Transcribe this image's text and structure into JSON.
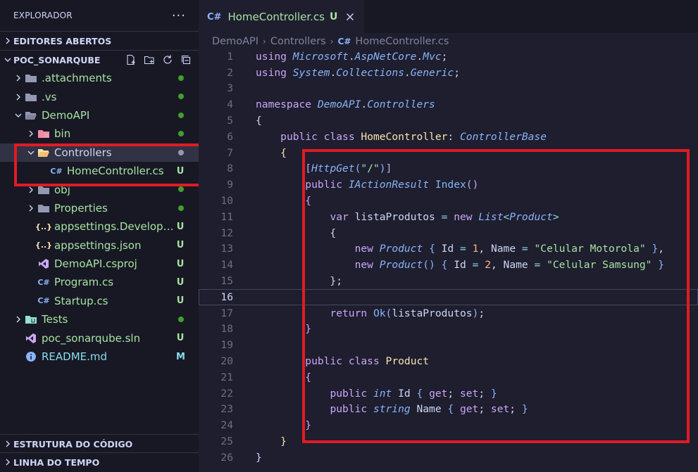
{
  "sidebar": {
    "title": "EXPLORADOR",
    "more": "···",
    "open_editors": "EDITORES ABERTOS",
    "project": "POC_SONARQUBE",
    "outline": "ESTRUTURA DO CÓDIGO",
    "timeline": "LINHA DO TEMPO",
    "tree": [
      {
        "label": "attachments",
        "prefix": ".",
        "display": ".attachments",
        "badge": "dot",
        "icon": "folder-icon"
      },
      {
        "display": ".vs",
        "badge": "dot",
        "icon": "folder-icon"
      },
      {
        "display": "DemoAPI",
        "badge": "dot",
        "icon": "folder-open-icon"
      },
      {
        "display": "bin",
        "badge": "dot",
        "icon": "folder-bin-icon"
      },
      {
        "display": "Controllers",
        "badge": "dot-grey",
        "icon": "folder-controllers-icon"
      },
      {
        "display": "HomeController.cs",
        "badge": "U",
        "icon": "csharp-icon"
      },
      {
        "display": "obj",
        "badge": "dot",
        "icon": "folder-icon"
      },
      {
        "display": "Properties",
        "badge": "dot",
        "icon": "folder-icon"
      },
      {
        "display": "appsettings.Developme...",
        "badge": "U",
        "icon": "json-icon"
      },
      {
        "display": "appsettings.json",
        "badge": "U",
        "icon": "json-icon"
      },
      {
        "display": "DemoAPI.csproj",
        "badge": "U",
        "icon": "vs-icon"
      },
      {
        "display": "Program.cs",
        "badge": "U",
        "icon": "csharp-icon"
      },
      {
        "display": "Startup.cs",
        "badge": "U",
        "icon": "csharp-icon"
      },
      {
        "display": "Tests",
        "badge": "dot",
        "icon": "folder-tests-icon"
      },
      {
        "display": "poc_sonarqube.sln",
        "badge": "U",
        "icon": "vs-icon"
      },
      {
        "display": "README.md",
        "badge": "M",
        "icon": "info-icon"
      }
    ]
  },
  "editor": {
    "tab": {
      "icon": "C#",
      "name": "HomeController.cs",
      "status": "U"
    },
    "breadcrumb": [
      "DemoAPI",
      "Controllers",
      "HomeController.cs"
    ],
    "breadcrumb_icon": "C#",
    "current_line": 16,
    "lines": [
      [
        [
          "k",
          "using"
        ],
        [
          "pl",
          " "
        ],
        [
          "t",
          "Microsoft"
        ],
        [
          "pl",
          "."
        ],
        [
          "t",
          "AspNetCore"
        ],
        [
          "pl",
          "."
        ],
        [
          "t",
          "Mvc"
        ],
        [
          "pl",
          ";"
        ]
      ],
      [
        [
          "k",
          "using"
        ],
        [
          "pl",
          " "
        ],
        [
          "t",
          "System"
        ],
        [
          "pl",
          "."
        ],
        [
          "t",
          "Collections"
        ],
        [
          "pl",
          "."
        ],
        [
          "t",
          "Generic"
        ],
        [
          "pl",
          ";"
        ]
      ],
      [],
      [
        [
          "k",
          "namespace"
        ],
        [
          "pl",
          " "
        ],
        [
          "t",
          "DemoAPI"
        ],
        [
          "pl",
          "."
        ],
        [
          "t",
          "Controllers"
        ]
      ],
      [
        [
          "pl",
          "{"
        ]
      ],
      [
        [
          "pl",
          "    "
        ],
        [
          "k",
          "public"
        ],
        [
          "pl",
          " "
        ],
        [
          "k",
          "class"
        ],
        [
          "pl",
          " "
        ],
        [
          "c",
          "HomeController"
        ],
        [
          "pl",
          ": "
        ],
        [
          "t",
          "ControllerBase"
        ]
      ],
      [
        [
          "pl",
          "    "
        ],
        [
          "br1",
          "{"
        ]
      ],
      [
        [
          "pl",
          "        "
        ],
        [
          "br2",
          "["
        ],
        [
          "t",
          "HttpGet"
        ],
        [
          "br3",
          "("
        ],
        [
          "s",
          "\"/\""
        ],
        [
          "br3",
          ")"
        ],
        [
          "br2",
          "]"
        ]
      ],
      [
        [
          "pl",
          "        "
        ],
        [
          "k",
          "public"
        ],
        [
          "pl",
          " "
        ],
        [
          "t",
          "IActionResult"
        ],
        [
          "pl",
          " "
        ],
        [
          "f",
          "Index"
        ],
        [
          "br2",
          "()"
        ]
      ],
      [
        [
          "pl",
          "        "
        ],
        [
          "br2",
          "{"
        ]
      ],
      [
        [
          "pl",
          "            "
        ],
        [
          "k",
          "var"
        ],
        [
          "pl",
          " listaProdutos "
        ],
        [
          "a",
          "="
        ],
        [
          "pl",
          " "
        ],
        [
          "k",
          "new"
        ],
        [
          "pl",
          " "
        ],
        [
          "t",
          "List"
        ],
        [
          "a",
          "<"
        ],
        [
          "t",
          "Product"
        ],
        [
          "a",
          ">"
        ]
      ],
      [
        [
          "pl",
          "            {"
        ]
      ],
      [
        [
          "pl",
          "                "
        ],
        [
          "k",
          "new"
        ],
        [
          "pl",
          " "
        ],
        [
          "t",
          "Product"
        ],
        [
          "pl",
          " "
        ],
        [
          "br3",
          "{"
        ],
        [
          "pl",
          " Id "
        ],
        [
          "a",
          "="
        ],
        [
          "pl",
          " "
        ],
        [
          "n",
          "1"
        ],
        [
          "pl",
          ", Name "
        ],
        [
          "a",
          "="
        ],
        [
          "pl",
          " "
        ],
        [
          "s",
          "\"Celular Motorola\""
        ],
        [
          "pl",
          " "
        ],
        [
          "br3",
          "}"
        ],
        [
          "pl",
          ","
        ]
      ],
      [
        [
          "pl",
          "                "
        ],
        [
          "k",
          "new"
        ],
        [
          "pl",
          " "
        ],
        [
          "t",
          "Product"
        ],
        [
          "br3",
          "()"
        ],
        [
          "pl",
          " "
        ],
        [
          "br3",
          "{"
        ],
        [
          "pl",
          " Id "
        ],
        [
          "a",
          "="
        ],
        [
          "pl",
          " "
        ],
        [
          "n",
          "2"
        ],
        [
          "pl",
          ", Name "
        ],
        [
          "a",
          "="
        ],
        [
          "pl",
          " "
        ],
        [
          "s",
          "\"Celular Samsung\""
        ],
        [
          "pl",
          " "
        ],
        [
          "br3",
          "}"
        ]
      ],
      [
        [
          "pl",
          "            };"
        ]
      ],
      [],
      [
        [
          "pl",
          "            "
        ],
        [
          "k",
          "return"
        ],
        [
          "pl",
          " "
        ],
        [
          "f",
          "Ok"
        ],
        [
          "br3",
          "("
        ],
        [
          "pl",
          "listaProdutos"
        ],
        [
          "br3",
          ")"
        ],
        [
          "pl",
          ";"
        ]
      ],
      [
        [
          "pl",
          "        "
        ],
        [
          "br2",
          "}"
        ]
      ],
      [],
      [
        [
          "pl",
          "        "
        ],
        [
          "k",
          "public"
        ],
        [
          "pl",
          " "
        ],
        [
          "k",
          "class"
        ],
        [
          "pl",
          " "
        ],
        [
          "c",
          "Product"
        ]
      ],
      [
        [
          "pl",
          "        "
        ],
        [
          "br2",
          "{"
        ]
      ],
      [
        [
          "pl",
          "            "
        ],
        [
          "k",
          "public"
        ],
        [
          "pl",
          " "
        ],
        [
          "t",
          "int"
        ],
        [
          "pl",
          " Id "
        ],
        [
          "br3",
          "{"
        ],
        [
          "pl",
          " "
        ],
        [
          "k",
          "get"
        ],
        [
          "pl",
          "; "
        ],
        [
          "k",
          "set"
        ],
        [
          "pl",
          "; "
        ],
        [
          "br3",
          "}"
        ]
      ],
      [
        [
          "pl",
          "            "
        ],
        [
          "k",
          "public"
        ],
        [
          "pl",
          " "
        ],
        [
          "t",
          "string"
        ],
        [
          "pl",
          " Name "
        ],
        [
          "br3",
          "{"
        ],
        [
          "pl",
          " "
        ],
        [
          "k",
          "get"
        ],
        [
          "pl",
          "; "
        ],
        [
          "k",
          "set"
        ],
        [
          "pl",
          "; "
        ],
        [
          "br3",
          "}"
        ]
      ],
      [
        [
          "pl",
          "        "
        ],
        [
          "br2",
          "}"
        ]
      ],
      [
        [
          "pl",
          "    "
        ],
        [
          "br1",
          "}"
        ]
      ],
      [
        [
          "pl",
          "}"
        ]
      ]
    ]
  },
  "colors": {
    "accent": "#89b4fa",
    "untracked": "#a6e3a1",
    "highlight_box": "#e01b24"
  }
}
